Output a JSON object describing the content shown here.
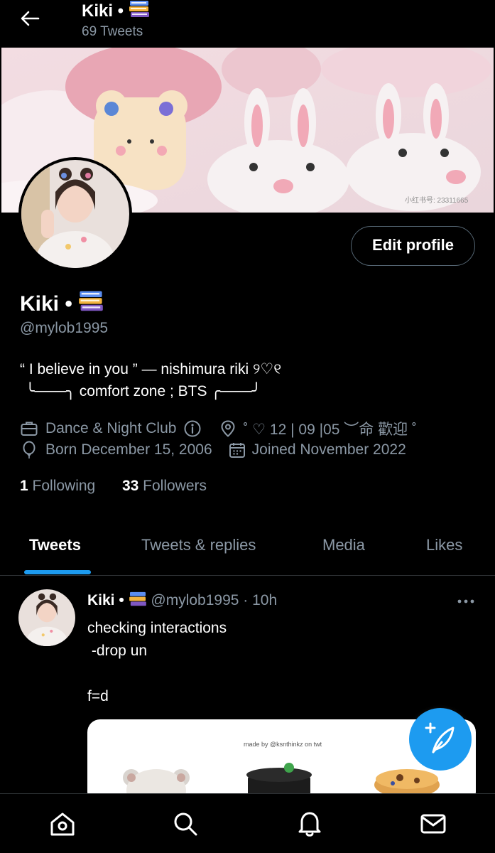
{
  "header": {
    "name": "Kiki •",
    "tweet_count": "69 Tweets"
  },
  "profile": {
    "edit_label": "Edit profile",
    "name": "Kiki •",
    "handle": "@mylob1995",
    "bio_line1": "“ I believe in you ” — nishimura riki ୨♡୧",
    "bio_line2_left": "╰───╮",
    "bio_line2_text": " comfort zone ; BTS ",
    "bio_line2_right": "╭───╯",
    "category": "Dance & Night Club",
    "location": "˚ ♡ 12 | 09 |05 ︶命 歡迎 ˚",
    "birthday": "Born December 15, 2006",
    "joined": "Joined November 2022",
    "following_count": "1",
    "following_label": "Following",
    "followers_count": "33",
    "followers_label": "Followers"
  },
  "tabs": [
    {
      "label": "Tweets",
      "active": true
    },
    {
      "label": "Tweets & replies",
      "active": false
    },
    {
      "label": "Media",
      "active": false
    },
    {
      "label": "Likes",
      "active": false
    }
  ],
  "tweet": {
    "name": "Kiki •",
    "handle": "@mylob1995",
    "time": "· 10h",
    "text": "checking interactions\n -drop un\n\nf=d",
    "card_caption": "made by @ksnthinkz on twt"
  },
  "banner": {
    "watermark": "小红书号: 23311665"
  },
  "nav": {
    "icons": [
      "home-icon",
      "search-icon",
      "notifications-icon",
      "messages-icon"
    ]
  },
  "colors": {
    "accent": "#1d9bf0",
    "background": "#000000",
    "secondary_text": "#8b98a5"
  }
}
